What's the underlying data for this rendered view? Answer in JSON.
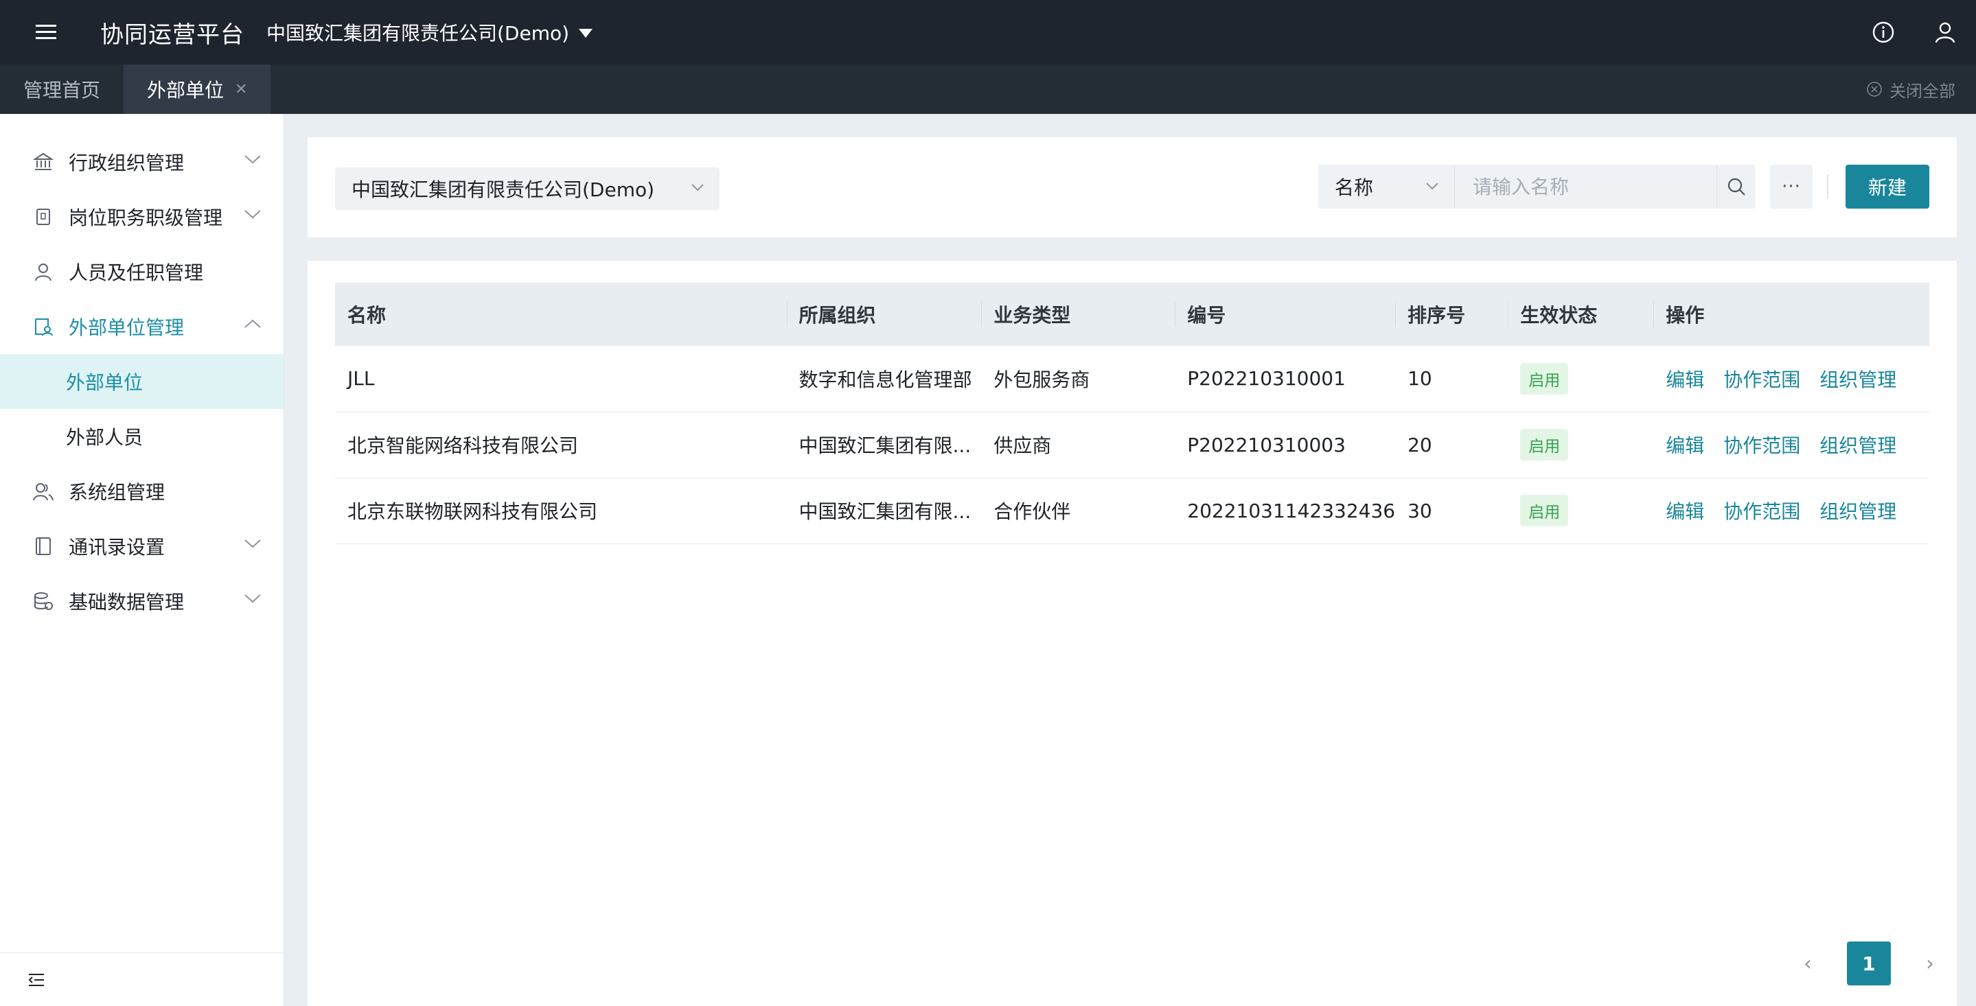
{
  "header": {
    "app_title": "协同运营平台",
    "company": "中国致汇集团有限责任公司(Demo)",
    "icons": [
      "menu-icon",
      "info-icon",
      "user-icon"
    ]
  },
  "tabs": {
    "items": [
      {
        "label": "管理首页",
        "active": false
      },
      {
        "label": "外部单位",
        "active": true,
        "closable": true
      }
    ],
    "close_all": "关闭全部"
  },
  "sidebar": {
    "items": [
      {
        "label": "行政组织管理",
        "icon": "bank-icon",
        "expandable": true,
        "open": false
      },
      {
        "label": "岗位职务职级管理",
        "icon": "badge-icon",
        "expandable": true,
        "open": false
      },
      {
        "label": "人员及任职管理",
        "icon": "person-icon",
        "expandable": false
      },
      {
        "label": "外部单位管理",
        "icon": "external-org-icon",
        "expandable": true,
        "open": true,
        "children": [
          {
            "label": "外部单位",
            "active": true
          },
          {
            "label": "外部人员",
            "active": false
          }
        ]
      },
      {
        "label": "系统组管理",
        "icon": "group-icon",
        "expandable": false
      },
      {
        "label": "通讯录设置",
        "icon": "contacts-icon",
        "expandable": true,
        "open": false
      },
      {
        "label": "基础数据管理",
        "icon": "database-icon",
        "expandable": true,
        "open": false
      }
    ]
  },
  "filter": {
    "org_select": "中国致汇集团有限责任公司(Demo)",
    "field_select": "名称",
    "search_placeholder": "请输入名称",
    "more_label": "···",
    "new_button": "新建"
  },
  "table": {
    "columns": [
      "名称",
      "所属组织",
      "业务类型",
      "编号",
      "排序号",
      "生效状态",
      "操作"
    ],
    "rows": [
      {
        "name": "JLL",
        "org": "数字和信息化管理部",
        "type": "外包服务商",
        "code": "P202210310001",
        "order": "10",
        "status": "启用"
      },
      {
        "name": "北京智能网络科技有限公司",
        "org": "中国致汇集团有限...",
        "type": "供应商",
        "code": "P202210310003",
        "order": "20",
        "status": "启用"
      },
      {
        "name": "北京东联物联网科技有限公司",
        "org": "中国致汇集团有限...",
        "type": "合作伙伴",
        "code": "20221031142332436",
        "order": "30",
        "status": "启用"
      }
    ],
    "actions": [
      "编辑",
      "协作范围",
      "组织管理"
    ]
  },
  "pagination": {
    "current_page": "1",
    "prev": "‹",
    "next": "›"
  },
  "colors": {
    "topbar": "#1e252e",
    "accent": "#1a869b",
    "status_green": "#38a150"
  }
}
